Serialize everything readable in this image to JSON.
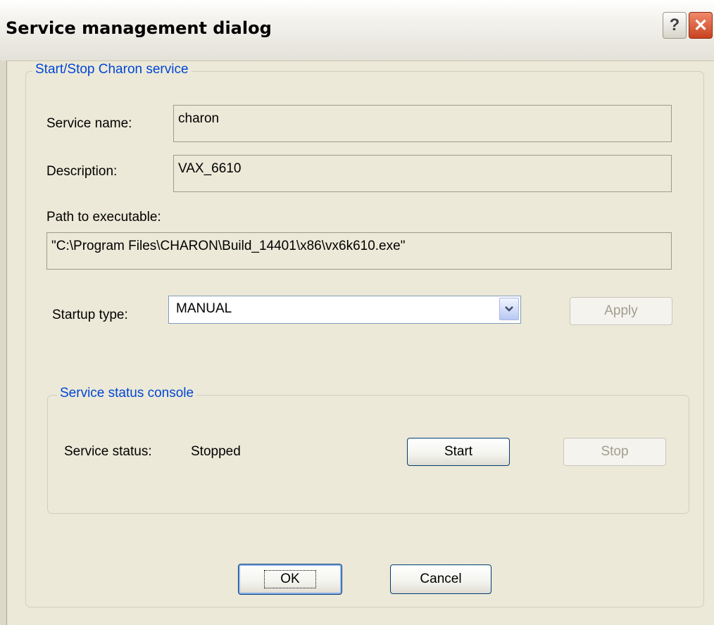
{
  "window": {
    "title": "Service management dialog",
    "help_glyph": "?",
    "close_glyph": "✕"
  },
  "service_group": {
    "legend": "Start/Stop Charon service",
    "service_name_label": "Service name:",
    "service_name_value": "charon",
    "description_label": "Description:",
    "description_value": "VAX_6610",
    "path_label": "Path to executable:",
    "path_value": "\"C:\\Program Files\\CHARON\\Build_14401\\x86\\vx6k610.exe\"",
    "startup_type_label": "Startup type:",
    "startup_type_value": "MANUAL",
    "apply_label": "Apply"
  },
  "status_group": {
    "legend": "Service status console",
    "status_label": "Service status:",
    "status_value": "Stopped",
    "start_label": "Start",
    "stop_label": "Stop"
  },
  "footer": {
    "ok_label": "OK",
    "cancel_label": "Cancel"
  },
  "colors": {
    "dialog_bg": "#ece9d8",
    "legend_text": "#0046d5",
    "close_button": "#c8421f"
  },
  "icons": {
    "help": "help-icon",
    "close": "close-icon",
    "dropdown": "chevron-down-icon"
  }
}
